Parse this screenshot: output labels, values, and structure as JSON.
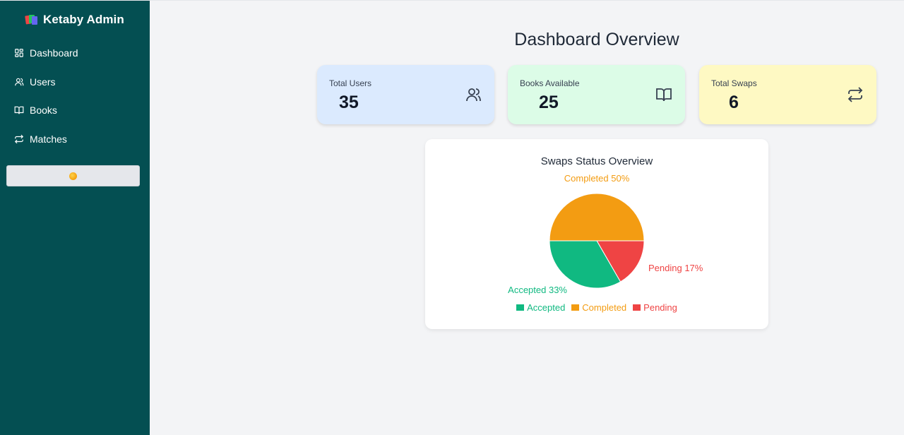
{
  "app": {
    "title": "Ketaby Admin"
  },
  "sidebar": {
    "items": [
      {
        "label": "Dashboard",
        "icon": "dashboard-icon"
      },
      {
        "label": "Users",
        "icon": "users-icon"
      },
      {
        "label": "Books",
        "icon": "book-icon"
      },
      {
        "label": "Matches",
        "icon": "swap-icon"
      }
    ],
    "theme_toggle": {
      "icon": "sun-icon"
    }
  },
  "main": {
    "title": "Dashboard Overview",
    "stats": [
      {
        "label": "Total Users",
        "value": "35",
        "icon": "users-icon",
        "color": "#dbeafe"
      },
      {
        "label": "Books Available",
        "value": "25",
        "icon": "book-icon",
        "color": "#dcfce7"
      },
      {
        "label": "Total Swaps",
        "value": "6",
        "icon": "swap-icon",
        "color": "#fef9c3"
      }
    ]
  },
  "chart_data": {
    "type": "pie",
    "title": "Swaps Status Overview",
    "slices": [
      {
        "name": "Completed",
        "value": 3,
        "label": "Completed 50%",
        "color": "#f39c12"
      },
      {
        "name": "Pending",
        "value": 1,
        "label": "Pending 17%",
        "color": "#ef4444"
      },
      {
        "name": "Accepted",
        "value": 2,
        "label": "Accepted 33%",
        "color": "#10b981"
      }
    ],
    "legend": [
      "Accepted",
      "Completed",
      "Pending"
    ],
    "legend_placement": "bottom"
  },
  "colors": {
    "sidebar_bg": "#044f52",
    "page_bg": "#f3f4f6",
    "accepted": "#10b981",
    "completed": "#f39c12",
    "pending": "#ef4444"
  }
}
